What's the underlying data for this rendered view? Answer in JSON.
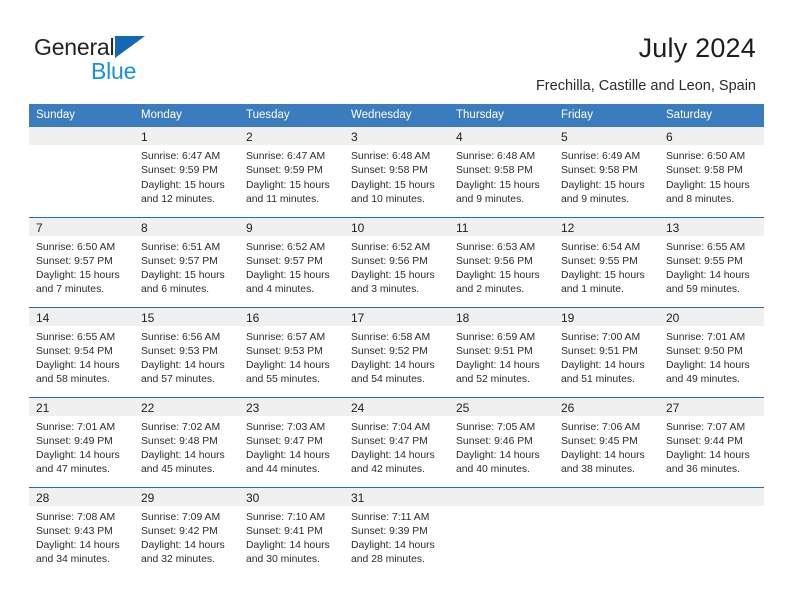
{
  "logo": {
    "word1": "General",
    "word2": "Blue",
    "triangle_color": "#1268b3",
    "blue_text_color": "#1a8fe0"
  },
  "header": {
    "title": "July 2024",
    "subtitle": "Frechilla, Castille and Leon, Spain"
  },
  "theme": {
    "header_row_bg": "#3a7cbe",
    "row_divider": "#1f6cb0",
    "daynum_bg": "#f0f0f0",
    "page_bg": "#ffffff"
  },
  "calendar": {
    "weekday_headers": [
      "Sunday",
      "Monday",
      "Tuesday",
      "Wednesday",
      "Thursday",
      "Friday",
      "Saturday"
    ],
    "weeks": [
      [
        {
          "day": "",
          "lines": []
        },
        {
          "day": "1",
          "lines": [
            "Sunrise: 6:47 AM",
            "Sunset: 9:59 PM",
            "Daylight: 15 hours",
            "and 12 minutes."
          ]
        },
        {
          "day": "2",
          "lines": [
            "Sunrise: 6:47 AM",
            "Sunset: 9:59 PM",
            "Daylight: 15 hours",
            "and 11 minutes."
          ]
        },
        {
          "day": "3",
          "lines": [
            "Sunrise: 6:48 AM",
            "Sunset: 9:58 PM",
            "Daylight: 15 hours",
            "and 10 minutes."
          ]
        },
        {
          "day": "4",
          "lines": [
            "Sunrise: 6:48 AM",
            "Sunset: 9:58 PM",
            "Daylight: 15 hours",
            "and 9 minutes."
          ]
        },
        {
          "day": "5",
          "lines": [
            "Sunrise: 6:49 AM",
            "Sunset: 9:58 PM",
            "Daylight: 15 hours",
            "and 9 minutes."
          ]
        },
        {
          "day": "6",
          "lines": [
            "Sunrise: 6:50 AM",
            "Sunset: 9:58 PM",
            "Daylight: 15 hours",
            "and 8 minutes."
          ]
        }
      ],
      [
        {
          "day": "7",
          "lines": [
            "Sunrise: 6:50 AM",
            "Sunset: 9:57 PM",
            "Daylight: 15 hours",
            "and 7 minutes."
          ]
        },
        {
          "day": "8",
          "lines": [
            "Sunrise: 6:51 AM",
            "Sunset: 9:57 PM",
            "Daylight: 15 hours",
            "and 6 minutes."
          ]
        },
        {
          "day": "9",
          "lines": [
            "Sunrise: 6:52 AM",
            "Sunset: 9:57 PM",
            "Daylight: 15 hours",
            "and 4 minutes."
          ]
        },
        {
          "day": "10",
          "lines": [
            "Sunrise: 6:52 AM",
            "Sunset: 9:56 PM",
            "Daylight: 15 hours",
            "and 3 minutes."
          ]
        },
        {
          "day": "11",
          "lines": [
            "Sunrise: 6:53 AM",
            "Sunset: 9:56 PM",
            "Daylight: 15 hours",
            "and 2 minutes."
          ]
        },
        {
          "day": "12",
          "lines": [
            "Sunrise: 6:54 AM",
            "Sunset: 9:55 PM",
            "Daylight: 15 hours",
            "and 1 minute."
          ]
        },
        {
          "day": "13",
          "lines": [
            "Sunrise: 6:55 AM",
            "Sunset: 9:55 PM",
            "Daylight: 14 hours",
            "and 59 minutes."
          ]
        }
      ],
      [
        {
          "day": "14",
          "lines": [
            "Sunrise: 6:55 AM",
            "Sunset: 9:54 PM",
            "Daylight: 14 hours",
            "and 58 minutes."
          ]
        },
        {
          "day": "15",
          "lines": [
            "Sunrise: 6:56 AM",
            "Sunset: 9:53 PM",
            "Daylight: 14 hours",
            "and 57 minutes."
          ]
        },
        {
          "day": "16",
          "lines": [
            "Sunrise: 6:57 AM",
            "Sunset: 9:53 PM",
            "Daylight: 14 hours",
            "and 55 minutes."
          ]
        },
        {
          "day": "17",
          "lines": [
            "Sunrise: 6:58 AM",
            "Sunset: 9:52 PM",
            "Daylight: 14 hours",
            "and 54 minutes."
          ]
        },
        {
          "day": "18",
          "lines": [
            "Sunrise: 6:59 AM",
            "Sunset: 9:51 PM",
            "Daylight: 14 hours",
            "and 52 minutes."
          ]
        },
        {
          "day": "19",
          "lines": [
            "Sunrise: 7:00 AM",
            "Sunset: 9:51 PM",
            "Daylight: 14 hours",
            "and 51 minutes."
          ]
        },
        {
          "day": "20",
          "lines": [
            "Sunrise: 7:01 AM",
            "Sunset: 9:50 PM",
            "Daylight: 14 hours",
            "and 49 minutes."
          ]
        }
      ],
      [
        {
          "day": "21",
          "lines": [
            "Sunrise: 7:01 AM",
            "Sunset: 9:49 PM",
            "Daylight: 14 hours",
            "and 47 minutes."
          ]
        },
        {
          "day": "22",
          "lines": [
            "Sunrise: 7:02 AM",
            "Sunset: 9:48 PM",
            "Daylight: 14 hours",
            "and 45 minutes."
          ]
        },
        {
          "day": "23",
          "lines": [
            "Sunrise: 7:03 AM",
            "Sunset: 9:47 PM",
            "Daylight: 14 hours",
            "and 44 minutes."
          ]
        },
        {
          "day": "24",
          "lines": [
            "Sunrise: 7:04 AM",
            "Sunset: 9:47 PM",
            "Daylight: 14 hours",
            "and 42 minutes."
          ]
        },
        {
          "day": "25",
          "lines": [
            "Sunrise: 7:05 AM",
            "Sunset: 9:46 PM",
            "Daylight: 14 hours",
            "and 40 minutes."
          ]
        },
        {
          "day": "26",
          "lines": [
            "Sunrise: 7:06 AM",
            "Sunset: 9:45 PM",
            "Daylight: 14 hours",
            "and 38 minutes."
          ]
        },
        {
          "day": "27",
          "lines": [
            "Sunrise: 7:07 AM",
            "Sunset: 9:44 PM",
            "Daylight: 14 hours",
            "and 36 minutes."
          ]
        }
      ],
      [
        {
          "day": "28",
          "lines": [
            "Sunrise: 7:08 AM",
            "Sunset: 9:43 PM",
            "Daylight: 14 hours",
            "and 34 minutes."
          ]
        },
        {
          "day": "29",
          "lines": [
            "Sunrise: 7:09 AM",
            "Sunset: 9:42 PM",
            "Daylight: 14 hours",
            "and 32 minutes."
          ]
        },
        {
          "day": "30",
          "lines": [
            "Sunrise: 7:10 AM",
            "Sunset: 9:41 PM",
            "Daylight: 14 hours",
            "and 30 minutes."
          ]
        },
        {
          "day": "31",
          "lines": [
            "Sunrise: 7:11 AM",
            "Sunset: 9:39 PM",
            "Daylight: 14 hours",
            "and 28 minutes."
          ]
        },
        {
          "day": "",
          "lines": []
        },
        {
          "day": "",
          "lines": []
        },
        {
          "day": "",
          "lines": []
        }
      ]
    ]
  }
}
